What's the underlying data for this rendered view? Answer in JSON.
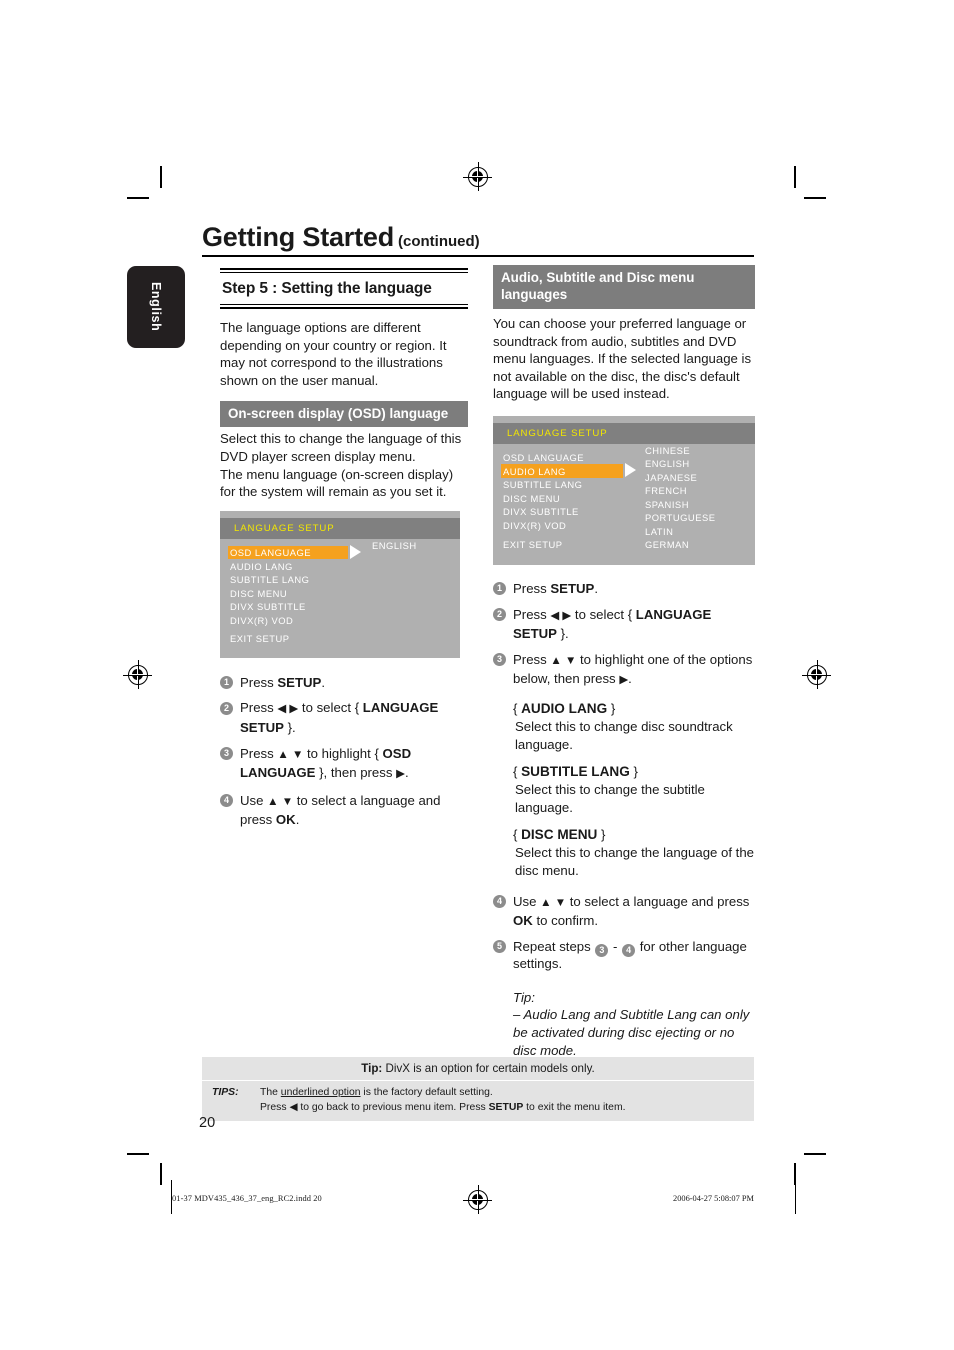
{
  "page": {
    "chapter_title": "Getting Started",
    "chapter_suffix": "(continued)",
    "side_tab": "English",
    "page_number": "20"
  },
  "left_column": {
    "step_title": "Step 5 : Setting the language",
    "intro": "The language options are different depending on your country or region. It may not correspond to the illustrations shown on the user manual.",
    "section_heading": "On-screen display (OSD) language",
    "section_body": "Select this to change the language of this DVD player screen display menu.\nThe menu language (on-screen display) for the system will remain as you set it.",
    "osd": {
      "title": "LANGUAGE  SETUP",
      "menu_items": [
        "OSD LANGUAGE",
        "AUDIO  LANG",
        "SUBTITLE  LANG",
        "DISC MENU",
        "DIVX SUBTITLE",
        "DIVX(R) VOD"
      ],
      "highlighted_item": "OSD LANGUAGE",
      "values": [
        "ENGLISH"
      ],
      "exit_label": "EXIT SETUP"
    },
    "steps": [
      {
        "num": "1",
        "parts": [
          {
            "t": "Press ",
            "b": false
          },
          {
            "t": "SETUP",
            "b": true
          },
          {
            "t": ".",
            "b": false
          }
        ]
      },
      {
        "num": "2",
        "parts": [
          {
            "t": "Press ",
            "b": false
          },
          {
            "t": "◀  ▶",
            "b": false
          },
          {
            "t": " to select { ",
            "b": false
          },
          {
            "t": "LANGUAGE SETUP",
            "b": true
          },
          {
            "t": " }.",
            "b": false
          }
        ]
      },
      {
        "num": "3",
        "parts": [
          {
            "t": "Press ",
            "b": false
          },
          {
            "t": "▲ ▼",
            "b": false
          },
          {
            "t": " to highlight { ",
            "b": false
          },
          {
            "t": "OSD LANGUAGE",
            "b": true
          },
          {
            "t": " }, then press ▶.",
            "b": false
          }
        ]
      },
      {
        "num": "4",
        "parts": [
          {
            "t": "Use ",
            "b": false
          },
          {
            "t": "▲ ▼",
            "b": false
          },
          {
            "t": " to select a language and press ",
            "b": false
          },
          {
            "t": "OK",
            "b": true
          },
          {
            "t": ".",
            "b": false
          }
        ]
      }
    ]
  },
  "right_column": {
    "section_heading": "Audio, Subtitle and Disc menu languages",
    "section_body": "You can choose your preferred language or soundtrack from audio, subtitles and DVD menu languages. If the selected language is not available on the disc, the disc's default language will be used instead.",
    "osd": {
      "title": "LANGUAGE  SETUP",
      "menu_items": [
        "OSD LANGUAGE",
        "AUDIO  LANG",
        "SUBTITLE  LANG",
        "DISC MENU",
        "DIVX SUBTITLE",
        "DIVX(R) VOD"
      ],
      "highlighted_item": "AUDIO  LANG",
      "values": [
        "CHINESE",
        "ENGLISH",
        "JAPANESE",
        "FRENCH",
        "SPANISH",
        "PORTUGUESE",
        "LATIN",
        "GERMAN"
      ],
      "exit_label": "EXIT SETUP"
    },
    "steps": [
      {
        "num": "1",
        "parts": [
          {
            "t": "Press ",
            "b": false
          },
          {
            "t": "SETUP",
            "b": true
          },
          {
            "t": ".",
            "b": false
          }
        ]
      },
      {
        "num": "2",
        "parts": [
          {
            "t": "Press ",
            "b": false
          },
          {
            "t": "◀  ▶",
            "b": false
          },
          {
            "t": " to select { ",
            "b": false
          },
          {
            "t": "LANGUAGE SETUP",
            "b": true
          },
          {
            "t": " }.",
            "b": false
          }
        ]
      },
      {
        "num": "3",
        "parts": [
          {
            "t": "Press ",
            "b": false
          },
          {
            "t": "▲ ▼",
            "b": false
          },
          {
            "t": " to highlight one of the options below, then press ▶.",
            "b": false
          }
        ]
      }
    ],
    "options": [
      {
        "label": "AUDIO LANG",
        "desc": "Select this to change disc soundtrack language."
      },
      {
        "label": "SUBTITLE LANG",
        "desc": "Select this to change the subtitle language."
      },
      {
        "label": "DISC MENU",
        "desc": "Select this to change the language of the disc menu."
      }
    ],
    "steps_tail": [
      {
        "num": "4",
        "parts": [
          {
            "t": "Use ",
            "b": false
          },
          {
            "t": "▲ ▼",
            "b": false
          },
          {
            "t": " to select a language and press ",
            "b": false
          },
          {
            "t": "OK",
            "b": true
          },
          {
            "t": " to confirm.",
            "b": false
          }
        ]
      }
    ],
    "repeat_step": {
      "num": "5",
      "pre": "Repeat steps ",
      "from": "3",
      "mid": " - ",
      "to": "4",
      "post": " for other language settings."
    },
    "tip": {
      "label": "Tip:",
      "text": "– Audio Lang and Subtitle Lang can only be activated during disc ejecting or no disc mode."
    }
  },
  "footer": {
    "tip_bold": "Tip:",
    "tip_text": " DivX is an option for certain models only.",
    "tips_label": "TIPS:",
    "tips_line1_pre": "The ",
    "tips_line1_underline": "underlined option",
    "tips_line1_post": " is the factory default setting.",
    "tips_line2_pre": "Press  ◀ to go back to previous menu item. Press ",
    "tips_line2_bold": "SETUP",
    "tips_line2_post": " to exit the menu item."
  },
  "production": {
    "file": "01-37 MDV435_436_37_eng_RC2.indd   20",
    "timestamp": "2006-04-27   5:08:07 PM"
  },
  "colors": {
    "osd_background": "#b0b0b0",
    "osd_titlebar": "#808080",
    "osd_title_text": "#f2e600",
    "osd_highlight": "#f5a11e",
    "section_bar": "#7d7d7d",
    "step_number": "#8c8c8c",
    "tab_background": "#231f20",
    "tips_background": "#e3e3e3"
  }
}
